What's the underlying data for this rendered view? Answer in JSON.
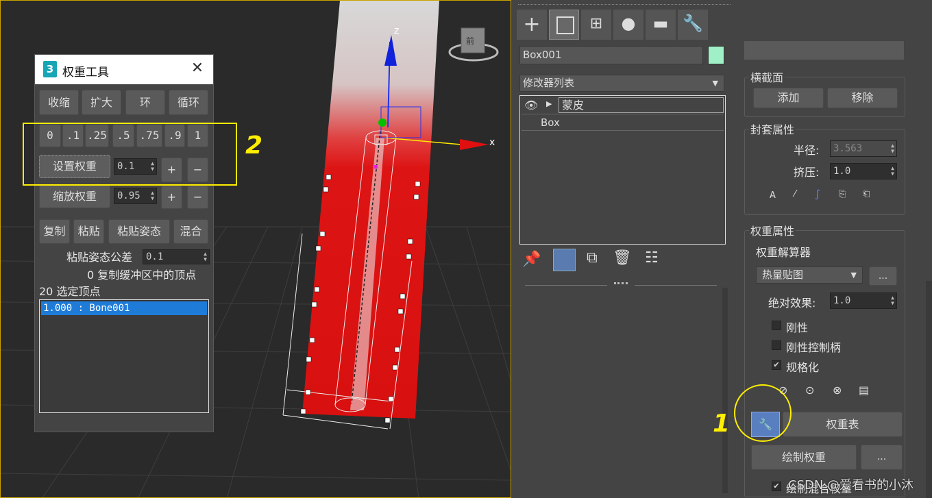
{
  "weight_tool": {
    "title": "权重工具",
    "row1": [
      "收缩",
      "扩大",
      "环",
      "循环"
    ],
    "presets": [
      "0",
      ".1",
      ".25",
      ".5",
      ".75",
      ".9",
      "1"
    ],
    "set_weight": "设置权重",
    "set_weight_value": "0.1",
    "plus": "+",
    "minus": "−",
    "scale_weight": "缩放权重",
    "scale_weight_value": "0.95",
    "row4": [
      "复制",
      "粘贴",
      "粘贴姿态",
      "混合"
    ],
    "paste_tolerance_label": "粘贴姿态公差",
    "paste_tolerance_value": "0.1",
    "buffer_info": "0 复制缓冲区中的顶点",
    "selected_info": "20 选定顶点",
    "vertex_list": [
      "1.000 : Bone001"
    ]
  },
  "annotations": {
    "box_number": "2",
    "circle_number": "1"
  },
  "viewport": {
    "axis_x": "x",
    "axis_z": "z",
    "viewcube_label": "前"
  },
  "modifier_panel": {
    "object_name": "Box001",
    "object_color": "#9ff0c6",
    "modifier_list_label": "修改器列表",
    "stack": [
      "蒙皮",
      "Box"
    ]
  },
  "skin_params": {
    "cross_section_title": "横截面",
    "add": "添加",
    "remove": "移除",
    "envelope_title": "封套属性",
    "radius_label": "半径:",
    "radius_value": "3.563",
    "squash_label": "挤压:",
    "squash_value": "1.0",
    "weight_props_title": "权重属性",
    "weight_solver_label": "权重解算器",
    "weight_solver_value": "热量贴图",
    "ellipsis": "...",
    "absolute_effect_label": "绝对效果:",
    "absolute_effect_value": "1.0",
    "rigid": "刚性",
    "rigid_handles": "刚性控制柄",
    "normalize": "规格化",
    "weight_table": "权重表",
    "paint_weights": "绘制权重",
    "paint_blend": "绘制混合权重"
  },
  "watermark": "CSDN @爱看书的小沐",
  "colors": {
    "annotation": "#ffee00",
    "selection": "#1e7bd8",
    "mesh": "#e01010"
  }
}
